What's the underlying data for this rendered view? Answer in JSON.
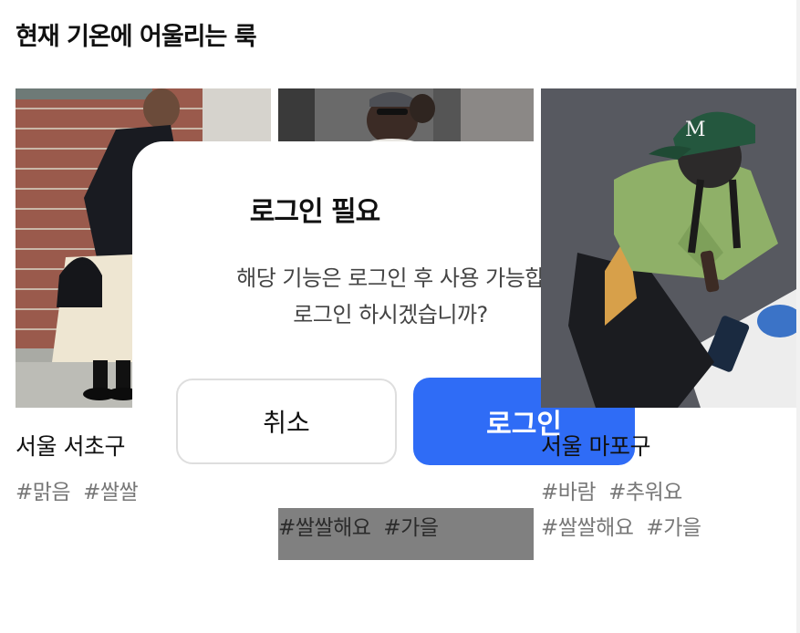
{
  "section": {
    "title": "현재 기온에 어울리는 룩"
  },
  "cards": [
    {
      "location": "서울 서초구",
      "tags": [
        "#맑음",
        "#쌀쌀"
      ]
    },
    {
      "location": "",
      "tags": [
        "#쌀쌀해요",
        "#가을"
      ]
    },
    {
      "location": "서울 마포구",
      "tags_line1": [
        "#바람",
        "#추워요"
      ],
      "tags_line2": [
        "#쌀쌀해요",
        "#가을"
      ]
    }
  ],
  "modal": {
    "title": "로그인 필요",
    "message_line1": "해당 기능은 로그인 후 사용 가능합",
    "message_line2": "로그인 하시겠습니까?",
    "cancel_label": "취소",
    "login_label": "로그인"
  },
  "photos": {
    "photo1": "woman-skirt-brick-wall",
    "photo2": "woman-sunglasses-cap",
    "photo3": "person-green-cap-sweater"
  },
  "colors": {
    "primary": "#2f6cf6",
    "tag_gray": "#777777"
  }
}
